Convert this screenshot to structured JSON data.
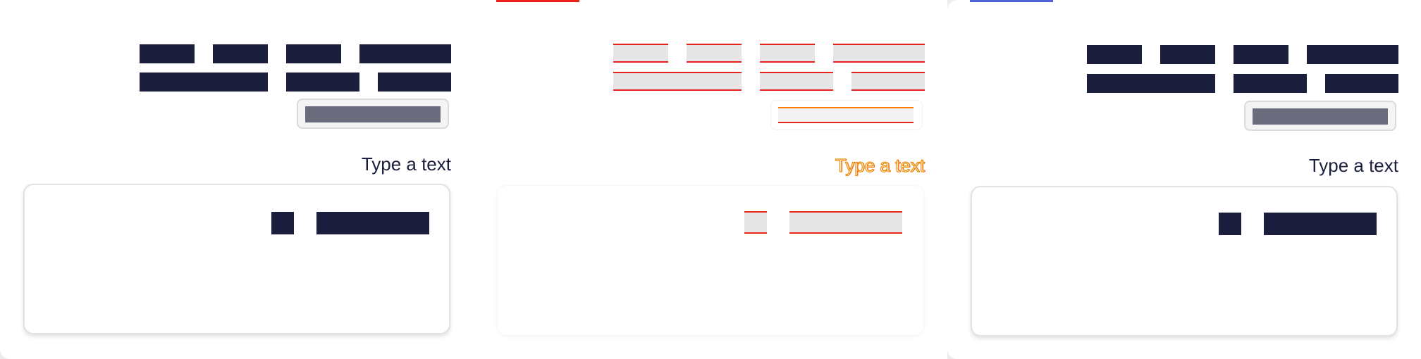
{
  "panels": [
    {
      "variant": "rendered",
      "input_label": "Type a text"
    },
    {
      "variant": "diff",
      "input_label": "Type a text"
    },
    {
      "variant": "rendered",
      "input_label": "Type a text"
    }
  ],
  "colors": {
    "ink": "#1b1f3d",
    "button_fill": "#6b6c7e",
    "diff_red": "#e8231d",
    "diff_orange": "#f08a00",
    "accent_blue": "#4f63d9"
  }
}
